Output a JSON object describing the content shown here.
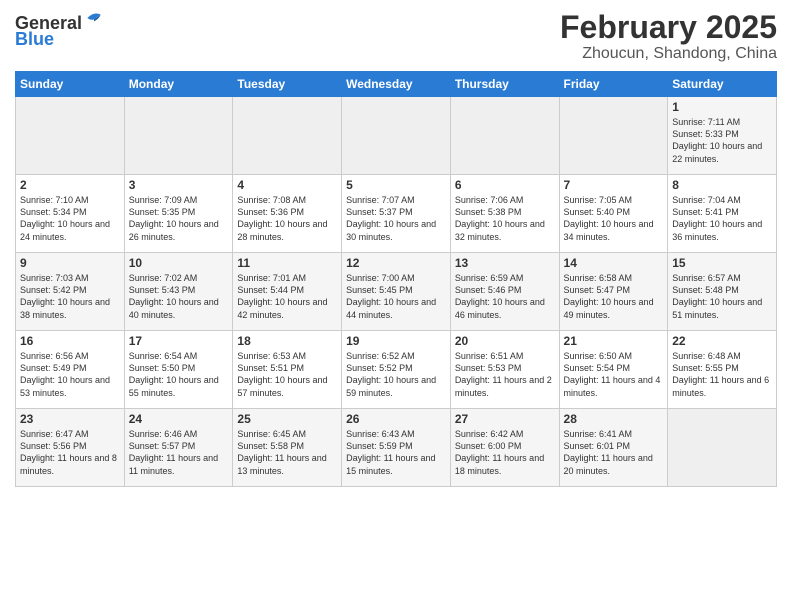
{
  "header": {
    "logo_line1": "General",
    "logo_line2": "Blue",
    "title": "February 2025",
    "subtitle": "Zhoucun, Shandong, China"
  },
  "days_of_week": [
    "Sunday",
    "Monday",
    "Tuesday",
    "Wednesday",
    "Thursday",
    "Friday",
    "Saturday"
  ],
  "weeks": [
    [
      {
        "day": "",
        "info": ""
      },
      {
        "day": "",
        "info": ""
      },
      {
        "day": "",
        "info": ""
      },
      {
        "day": "",
        "info": ""
      },
      {
        "day": "",
        "info": ""
      },
      {
        "day": "",
        "info": ""
      },
      {
        "day": "1",
        "info": "Sunrise: 7:11 AM\nSunset: 5:33 PM\nDaylight: 10 hours\nand 22 minutes."
      }
    ],
    [
      {
        "day": "2",
        "info": "Sunrise: 7:10 AM\nSunset: 5:34 PM\nDaylight: 10 hours\nand 24 minutes."
      },
      {
        "day": "3",
        "info": "Sunrise: 7:09 AM\nSunset: 5:35 PM\nDaylight: 10 hours\nand 26 minutes."
      },
      {
        "day": "4",
        "info": "Sunrise: 7:08 AM\nSunset: 5:36 PM\nDaylight: 10 hours\nand 28 minutes."
      },
      {
        "day": "5",
        "info": "Sunrise: 7:07 AM\nSunset: 5:37 PM\nDaylight: 10 hours\nand 30 minutes."
      },
      {
        "day": "6",
        "info": "Sunrise: 7:06 AM\nSunset: 5:38 PM\nDaylight: 10 hours\nand 32 minutes."
      },
      {
        "day": "7",
        "info": "Sunrise: 7:05 AM\nSunset: 5:40 PM\nDaylight: 10 hours\nand 34 minutes."
      },
      {
        "day": "8",
        "info": "Sunrise: 7:04 AM\nSunset: 5:41 PM\nDaylight: 10 hours\nand 36 minutes."
      }
    ],
    [
      {
        "day": "9",
        "info": "Sunrise: 7:03 AM\nSunset: 5:42 PM\nDaylight: 10 hours\nand 38 minutes."
      },
      {
        "day": "10",
        "info": "Sunrise: 7:02 AM\nSunset: 5:43 PM\nDaylight: 10 hours\nand 40 minutes."
      },
      {
        "day": "11",
        "info": "Sunrise: 7:01 AM\nSunset: 5:44 PM\nDaylight: 10 hours\nand 42 minutes."
      },
      {
        "day": "12",
        "info": "Sunrise: 7:00 AM\nSunset: 5:45 PM\nDaylight: 10 hours\nand 44 minutes."
      },
      {
        "day": "13",
        "info": "Sunrise: 6:59 AM\nSunset: 5:46 PM\nDaylight: 10 hours\nand 46 minutes."
      },
      {
        "day": "14",
        "info": "Sunrise: 6:58 AM\nSunset: 5:47 PM\nDaylight: 10 hours\nand 49 minutes."
      },
      {
        "day": "15",
        "info": "Sunrise: 6:57 AM\nSunset: 5:48 PM\nDaylight: 10 hours\nand 51 minutes."
      }
    ],
    [
      {
        "day": "16",
        "info": "Sunrise: 6:56 AM\nSunset: 5:49 PM\nDaylight: 10 hours\nand 53 minutes."
      },
      {
        "day": "17",
        "info": "Sunrise: 6:54 AM\nSunset: 5:50 PM\nDaylight: 10 hours\nand 55 minutes."
      },
      {
        "day": "18",
        "info": "Sunrise: 6:53 AM\nSunset: 5:51 PM\nDaylight: 10 hours\nand 57 minutes."
      },
      {
        "day": "19",
        "info": "Sunrise: 6:52 AM\nSunset: 5:52 PM\nDaylight: 10 hours\nand 59 minutes."
      },
      {
        "day": "20",
        "info": "Sunrise: 6:51 AM\nSunset: 5:53 PM\nDaylight: 11 hours\nand 2 minutes."
      },
      {
        "day": "21",
        "info": "Sunrise: 6:50 AM\nSunset: 5:54 PM\nDaylight: 11 hours\nand 4 minutes."
      },
      {
        "day": "22",
        "info": "Sunrise: 6:48 AM\nSunset: 5:55 PM\nDaylight: 11 hours\nand 6 minutes."
      }
    ],
    [
      {
        "day": "23",
        "info": "Sunrise: 6:47 AM\nSunset: 5:56 PM\nDaylight: 11 hours\nand 8 minutes."
      },
      {
        "day": "24",
        "info": "Sunrise: 6:46 AM\nSunset: 5:57 PM\nDaylight: 11 hours\nand 11 minutes."
      },
      {
        "day": "25",
        "info": "Sunrise: 6:45 AM\nSunset: 5:58 PM\nDaylight: 11 hours\nand 13 minutes."
      },
      {
        "day": "26",
        "info": "Sunrise: 6:43 AM\nSunset: 5:59 PM\nDaylight: 11 hours\nand 15 minutes."
      },
      {
        "day": "27",
        "info": "Sunrise: 6:42 AM\nSunset: 6:00 PM\nDaylight: 11 hours\nand 18 minutes."
      },
      {
        "day": "28",
        "info": "Sunrise: 6:41 AM\nSunset: 6:01 PM\nDaylight: 11 hours\nand 20 minutes."
      },
      {
        "day": "",
        "info": ""
      }
    ]
  ]
}
